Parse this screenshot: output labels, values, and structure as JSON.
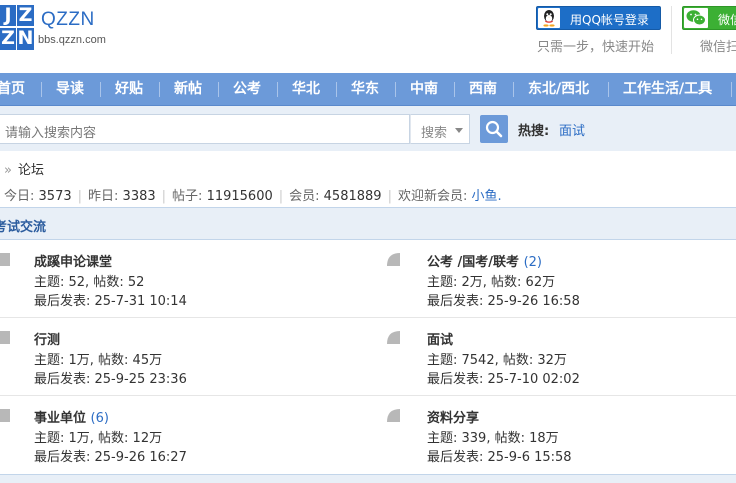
{
  "logo": {
    "tiles": [
      "J",
      "Z",
      "Z",
      "N"
    ],
    "name": "QZZN",
    "domain": "bbs.qzzn.com"
  },
  "login": {
    "qq_label": "用QQ帐号登录",
    "qq_sub": "只需一步，快速开始",
    "wx_label": "微信",
    "wx_sub": "微信扫"
  },
  "nav": {
    "items": [
      "首页",
      "导读",
      "好贴",
      "新帖",
      "公考",
      "华北",
      "华东",
      "中南",
      "西南",
      "东北/西北",
      "工作生活/工具"
    ]
  },
  "search": {
    "placeholder": "请输入搜索内容",
    "type_label": "搜索",
    "hot_label": "热搜:",
    "hot_link": "面试"
  },
  "breadcrumb": {
    "arrow": "»",
    "current": "论坛"
  },
  "stats": {
    "today_label": "今日:",
    "today": "3573",
    "yesterday_label": "昨日:",
    "yesterday": "3383",
    "posts_label": "帖子:",
    "posts": "11915600",
    "members_label": "会员:",
    "members": "4581889",
    "welcome_label": "欢迎新会员:",
    "new_member": "小鱼."
  },
  "section": {
    "title": "考试交流"
  },
  "forums": [
    {
      "name": "成蹊申论课堂",
      "count": "",
      "topics_line": "主题: 52, 帖数: 52",
      "last_line": "最后发表: 25-7-31 10:14"
    },
    {
      "name": "公考 /国考/联考",
      "count": "(2)",
      "topics_line": "主题: 2万, 帖数: 62万",
      "last_line": "最后发表: 25-9-26 16:58"
    },
    {
      "name": "行测",
      "count": "",
      "topics_line": "主题: 1万, 帖数: 45万",
      "last_line": "最后发表: 25-9-25 23:36"
    },
    {
      "name": "面试",
      "count": "",
      "topics_line": "主题: 7542, 帖数: 32万",
      "last_line": "最后发表: 25-7-10 02:02"
    },
    {
      "name": "事业单位",
      "count": "(6)",
      "topics_line": "主题: 1万, 帖数: 12万",
      "last_line": "最后发表: 25-9-26 16:27"
    },
    {
      "name": "资料分享",
      "count": "",
      "topics_line": "主题: 339, 帖数: 18万",
      "last_line": "最后发表: 25-9-6 15:58"
    }
  ],
  "colors": {
    "brand_blue": "#2b6cc4",
    "nav_blue": "#6c9ad9",
    "search_band": "#e8eff7",
    "qq_blue": "#1d6ec7",
    "wechat_green": "#3cb034"
  }
}
